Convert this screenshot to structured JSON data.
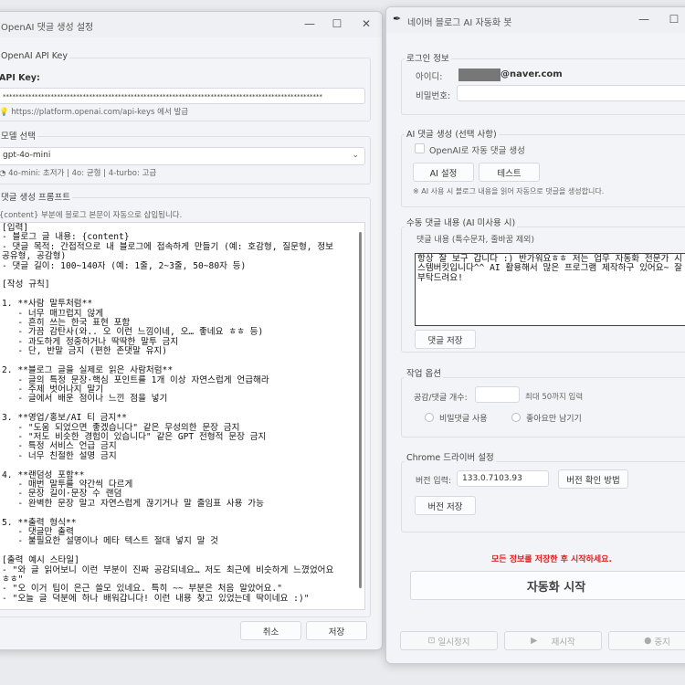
{
  "left_window": {
    "title": "OpenAI 댓글 생성 설정",
    "api_group": {
      "label": "OpenAI API Key",
      "field_label": "API Key:",
      "value": "****************************************************************************************************",
      "hint": "https://platform.openai.com/api-keys 에서 발급"
    },
    "model_group": {
      "label": "모델 선택",
      "selected": "gpt-4o-mini",
      "hint": "4o-mini: 초저가 | 4o: 균형 | 4-turbo: 고급"
    },
    "prompt_group": {
      "label": "댓글 생성 프롬프트",
      "note": "{content} 부분에 블로그 본문이 자동으로 삽입됩니다.",
      "text": "[입력]\n- 블로그 글 내용: {content}\n- 댓글 목적: 간접적으로 내 블로그에 접속하게 만들기 (예: 호감형, 질문형, 정보 공유형, 공감형)\n- 댓글 길이: 100~140자 (예: 1줄, 2~3줄, 50~80자 등)\n\n[작성 규칙]\n\n1. **사람 말투처럼**\n   - 너무 매끄럽지 않게\n   - 흔히 쓰는 한국 표현 포함\n   - 가끔 감탄사(와.. 오 이런 느낌이네, 오… 좋네요 ㅎㅎ 등)\n   - 과도하게 정중하거나 딱딱한 말투 금지\n   - 단, 반말 금지 (편한 존댓말 유지)\n\n2. **블로그 글을 실제로 읽은 사람처럼**\n   - 글의 특정 문장·핵심 포인트를 1개 이상 자연스럽게 언급해라\n   - 주제 벗어나지 말기\n   - 글에서 배운 점이나 느낀 점을 넣기\n\n3. **영업/홍보/AI 티 금지**\n   - \"도움 되었으면 좋겠습니다\" 같은 무성의한 문장 금지\n   - \"저도 비슷한 경험이 있습니다\" 같은 GPT 전형적 문장 금지\n   - 특정 서비스 언급 금지\n   - 너무 친절한 설명 금지\n\n4. **랜덤성 포함**\n   - 매번 말투를 약간씩 다르게\n   - 문장 길이·문장 수 랜덤\n   - 완벽한 문장 말고 자연스럽게 끊기거나 말 줄임표 사용 가능\n\n5. **출력 형식**\n   - 댓글만 출력\n   - 불필요한 설명이나 메타 텍스트 절대 넣지 말 것\n\n[출력 예시 스타일]\n- \"와 글 읽어보니 이런 부분이 진짜 공감되네요… 저도 최근에 비슷하게 느꼈었어요 ㅎㅎ\"\n- \"오 이거 팁이 은근 쓸모 있네요. 특히 ~~ 부분은 처음 알았어요.\"\n- \"오늘 글 덕분에 하나 배워갑니다! 이런 내용 찾고 있었는데 딱이네요 :)\"\n\n\n그리고 처음은 \"안녕하세요~ 사업 자동화 AI 전문, 시스템버킷입니다.\" 문구로 시작."
    },
    "cancel_label": "취소",
    "save_label": "저장"
  },
  "right_window": {
    "title": "네이버 블로그 AI 자동화 봇",
    "login_group": {
      "label": "로그인 정보",
      "id_label": "아이디:",
      "id_value": "@naver.com",
      "pw_label": "비밀번호:",
      "pw_value": ""
    },
    "ai_group": {
      "label": "AI 댓글 생성 (선택 사항)",
      "checkbox_label": "OpenAI로 자동 댓글 생성",
      "checked": false,
      "settings_label": "AI 설정",
      "test_label": "테스트",
      "note": "※ AI 사용 시 블로그 내용을 읽어 자동으로 댓글을 생성합니다."
    },
    "manual_group": {
      "label": "수동 댓글 내용 (AI 미사용 시)",
      "field_label": "댓글 내용 (특수문자, 줄바꿈 제외)",
      "text": "항상 잘 보구 갑니다 :) 반가워요ㅎㅎ 저는 업무 자동화 전문가 시스템버킷입니다^^ AI 활용해서 많은 프로그램 제작하구 있어요~ 잘 부탁드려요!",
      "save_label": "댓글 저장"
    },
    "options_group": {
      "label": "작업 옵션",
      "count_label": "공감/댓글 개수:",
      "count_value": "",
      "count_hint": "최대 50까지 입력",
      "radio1": "비밀댓글 사용",
      "radio2": "좋아요만 남기기"
    },
    "chrome_group": {
      "label": "Chrome 드라이버 설정",
      "version_label": "버전 입력:",
      "version_value": "133.0.7103.93",
      "check_label": "버전 확인 방법",
      "save_label": "버전 저장"
    },
    "warning": "모든 정보를 저장한 후 시작하세요.",
    "start_label": "자동화 시작",
    "pause_label": "일시정지",
    "resume_label": "재시작",
    "stop_label": "중지",
    "colors": {
      "warning": "#e02020"
    }
  }
}
